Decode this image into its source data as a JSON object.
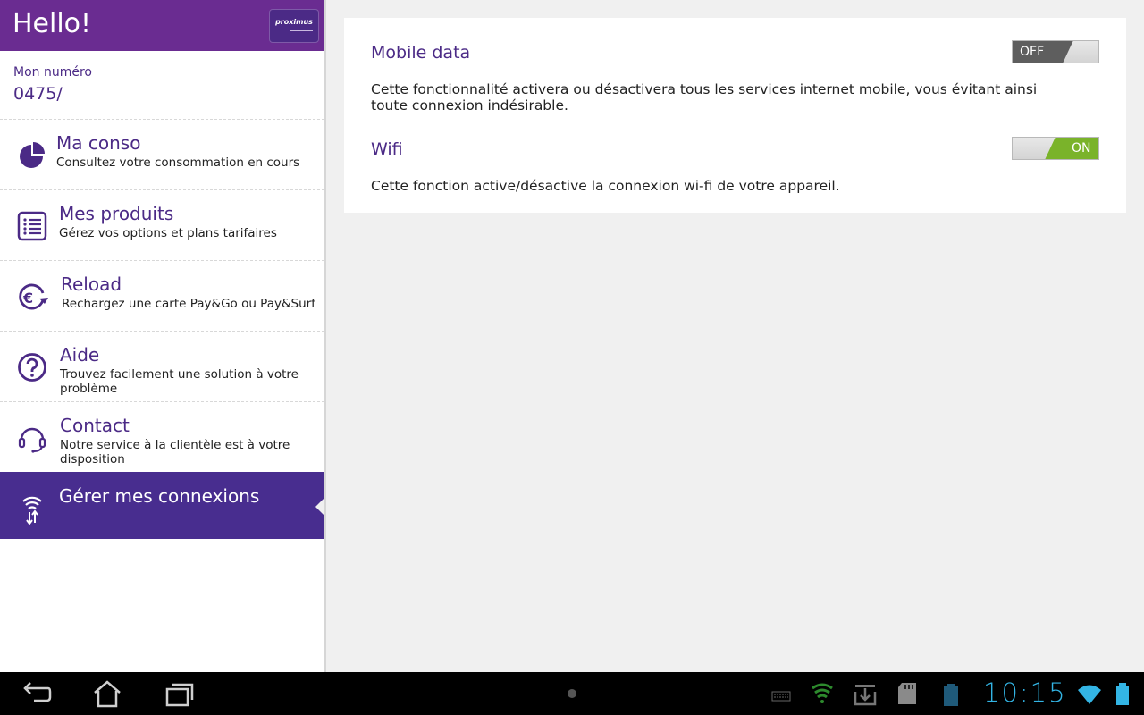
{
  "sidebar": {
    "header_title": "Hello!",
    "logo_text": "proximus",
    "number_label": "Mon numéro",
    "number_value": "0475/",
    "items": [
      {
        "title": "Ma conso",
        "subtitle": "Consultez votre consommation en cours",
        "icon": "pie-chart-icon"
      },
      {
        "title": "Mes produits",
        "subtitle": "Gérez vos options et plans tarifaires",
        "icon": "list-icon"
      },
      {
        "title": "Reload",
        "subtitle": "Rechargez une carte Pay&Go ou Pay&Surf",
        "icon": "euro-reload-icon"
      },
      {
        "title": "Aide",
        "subtitle": "Trouvez facilement une solution à votre problème",
        "icon": "help-icon"
      },
      {
        "title": "Contact",
        "subtitle": "Notre service à la clientèle est à votre disposition",
        "icon": "headset-icon"
      },
      {
        "title": "Gérer mes connexions",
        "subtitle": "",
        "icon": "connection-icon",
        "active": true
      }
    ]
  },
  "settings": {
    "mobile_data": {
      "title": "Mobile data",
      "description": "Cette fonctionnalité activera ou désactivera tous les services internet mobile, vous évitant ainsi toute connexion indésirable.",
      "toggle_label": "OFF"
    },
    "wifi": {
      "title": "Wifi",
      "description": "Cette fonction active/désactive la connexion wi-fi de votre appareil.",
      "toggle_label": "ON"
    }
  },
  "statusbar": {
    "time": "10:15"
  },
  "colors": {
    "header_purple": "#6a2c91",
    "active_purple": "#482d8f",
    "text_purple": "#4b2a86",
    "toggle_on": "#7ab32a",
    "toggle_off": "#5e5e5e",
    "clock_blue": "#33b5e5"
  }
}
